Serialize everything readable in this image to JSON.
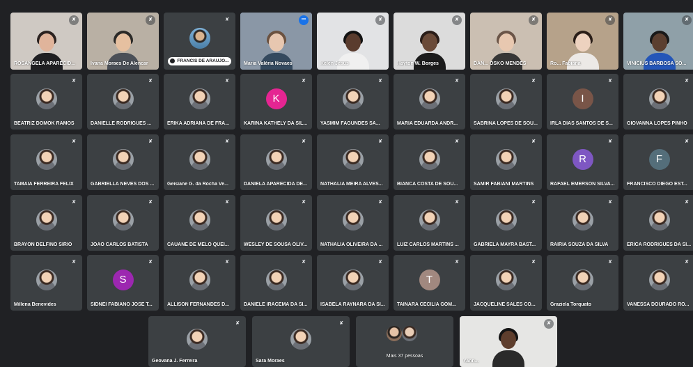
{
  "colors": {
    "tile": "#3c4043",
    "background": "#202124",
    "accent": "#8ab4f8"
  },
  "tiles": [
    {
      "name": "ROSANGELA APARECID...",
      "type": "video",
      "icon": "mic-off-icon"
    },
    {
      "name": "Ivana Moraes De Alencar",
      "type": "video",
      "icon": "mic-off-icon"
    },
    {
      "name": "FRANCIS DE ARAUJO...",
      "type": "chip",
      "icon": "mic-off-icon"
    },
    {
      "name": "Maria Valéria Novaes",
      "type": "video",
      "icon": "more-options-icon",
      "active": true
    },
    {
      "name": "Kelen Jesus",
      "type": "video",
      "icon": "mic-off-icon"
    },
    {
      "name": "Hayton W. Borges",
      "type": "video",
      "icon": "mic-off-icon"
    },
    {
      "name": "DAN... OSKO MENDES",
      "type": "video",
      "icon": "mic-off-icon"
    },
    {
      "name": "Ro... Fabiana",
      "type": "video",
      "icon": "mic-off-icon"
    },
    {
      "name": "VINICIUS BARBOSA SO...",
      "type": "video",
      "icon": "mic-off-icon"
    },
    {
      "name": "BEATRIZ DOMOK RAMOS",
      "type": "photo"
    },
    {
      "name": "DANIELLE RODRIGUES ...",
      "type": "photo"
    },
    {
      "name": "ERIKA ADRIANA DE FRA...",
      "type": "photo"
    },
    {
      "name": "KARINA KATHELY DA SIL...",
      "type": "letter",
      "letter": "K",
      "color": "#e52592"
    },
    {
      "name": "YASMIM FAGUNDES SA...",
      "type": "photo"
    },
    {
      "name": "MARIA EDUARDA ANDR...",
      "type": "photo"
    },
    {
      "name": "SABRINA LOPES DE SOU...",
      "type": "photo"
    },
    {
      "name": "IRLA DIAS SANTOS DE S...",
      "type": "letter",
      "letter": "I",
      "color": "#795548"
    },
    {
      "name": "GIOVANNA LOPES PINHO",
      "type": "photo"
    },
    {
      "name": "TAMAIA FERREIRA FELIX",
      "type": "photo"
    },
    {
      "name": "GABRIELLA NEVES DOS ...",
      "type": "photo"
    },
    {
      "name": "Geisiane G. da Rocha Ve...",
      "type": "photo"
    },
    {
      "name": "DANIELA APARECIDA DE...",
      "type": "photo"
    },
    {
      "name": "NATHALIA MEIRA ALVES...",
      "type": "photo"
    },
    {
      "name": "BIANCA COSTA DE SOU...",
      "type": "photo"
    },
    {
      "name": "SAMIR FABIANI MARTINS",
      "type": "photo"
    },
    {
      "name": "RAFAEL EMERSON SILVA...",
      "type": "letter",
      "letter": "R",
      "color": "#7e57c2"
    },
    {
      "name": "FRANCISCO DIEGO EST...",
      "type": "letter",
      "letter": "F",
      "color": "#546e7a"
    },
    {
      "name": "BRAYON DELFINO SIRIO",
      "type": "photo"
    },
    {
      "name": "JOAO CARLOS BATISTA",
      "type": "photo"
    },
    {
      "name": "CAUANE DE MELO QUEI...",
      "type": "photo"
    },
    {
      "name": "WESLEY DE SOUSA OLIV...",
      "type": "photo"
    },
    {
      "name": "NATHALIA OLIVEIRA DA ...",
      "type": "photo"
    },
    {
      "name": "LUIZ CARLOS MARTINS ...",
      "type": "photo"
    },
    {
      "name": "GABRIELA MAYRA BAST...",
      "type": "photo"
    },
    {
      "name": "RAIRIA SOUZA DA SILVA",
      "type": "photo"
    },
    {
      "name": "ERICA RODRIGUES DA SI...",
      "type": "photo"
    },
    {
      "name": "Millena Benevides",
      "type": "photo"
    },
    {
      "name": "SIDNEI FABIANO JOSE T...",
      "type": "letter",
      "letter": "S",
      "color": "#9c27b0"
    },
    {
      "name": "ALLISON FERNANDES D...",
      "type": "photo"
    },
    {
      "name": "DANIELE IRACEMA DA SI...",
      "type": "photo"
    },
    {
      "name": "ISABELA RAYNARA DA SI...",
      "type": "photo"
    },
    {
      "name": "TAINARA CECILIA GOM...",
      "type": "letter",
      "letter": "T",
      "color": "#a1887f"
    },
    {
      "name": "JACQUELINE SALES CO...",
      "type": "photo"
    },
    {
      "name": "Graziela Torquato",
      "type": "photo"
    },
    {
      "name": "VANESSA DOURADO RO...",
      "type": "photo"
    },
    {
      "name": "Geovana J. Ferreira",
      "type": "photo"
    },
    {
      "name": "Sara Moraes",
      "type": "photo"
    },
    {
      "name": "Mais 37 pessoas",
      "type": "more"
    },
    {
      "name": "Yann...",
      "type": "selfvideo"
    }
  ]
}
